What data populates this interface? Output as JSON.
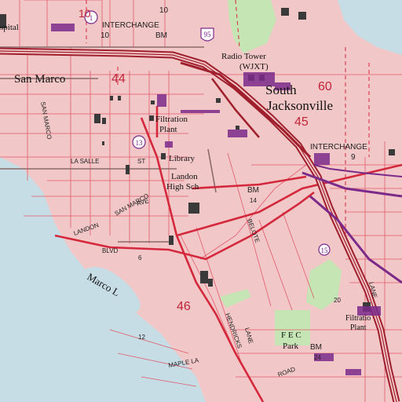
{
  "map": {
    "places": {
      "hospital_partial": "spital",
      "san_marco": "San Marco",
      "south_jacksonville_1": "South",
      "south_jacksonville_2": "Jacksonville",
      "radio_tower_1": "Radio Tower",
      "radio_tower_2": "(WJXT)",
      "filtration_plant_1": "Filtration",
      "filtration_plant_2": "Plant",
      "library": "Library",
      "landon_1": "Landon",
      "landon_2": "High Sch",
      "fec_park_1": "F E C",
      "fec_park_2": "Park",
      "marco_lake": "Marco L",
      "filtration_plant_e_1": "Filtratio",
      "filtration_plant_e_2": "Plant"
    },
    "interchanges": {
      "interchange_10_label": "INTERCHANGE",
      "interchange_10_number": "10",
      "interchange_9_label": "INTERCHANGE",
      "interchange_9_number": "9"
    },
    "streets": {
      "san_marco_1": "SAN MARCO",
      "san_marco_2": "SAN MARCO",
      "la_salle": "LA SALLE",
      "st": "ST",
      "landon_ave_1": "LANDON",
      "landon_ave_2": "AVE",
      "blvd": "BLVD",
      "hendricks": "HENDRICKS",
      "beloit": "BELOTE",
      "maple": "MAPLE LA",
      "road": "ROAD",
      "lane_1": "LANE",
      "lane_2": "LANE"
    },
    "markers": {
      "bm_top": "BM",
      "bm_top_num": "10",
      "bm_mid": "BM",
      "bm_mid_num": "14",
      "bm_low": "BM",
      "bm_low_num": "24",
      "num_10_top": "10",
      "num_6": "6",
      "num_12": "12",
      "num_20": "20"
    },
    "routes": {
      "i95": "95",
      "us1_left": "1",
      "s13": "13",
      "s15": "15",
      "i95_small": "95"
    },
    "section_numbers": {
      "sec_44": "44",
      "sec_45": "45",
      "sec_46": "46",
      "sec_60": "60",
      "sec_10": "10"
    },
    "colors": {
      "urban": "#f2c7c7",
      "water": "#c7dde6",
      "park": "#c5e6b4",
      "road_red": "#d4283c",
      "road_grey": "#8a6a6a",
      "interstate": "#a01f2d",
      "grid": "#e05a6a",
      "building": "#3a3a3a",
      "purple": "#7b2a8a"
    }
  }
}
